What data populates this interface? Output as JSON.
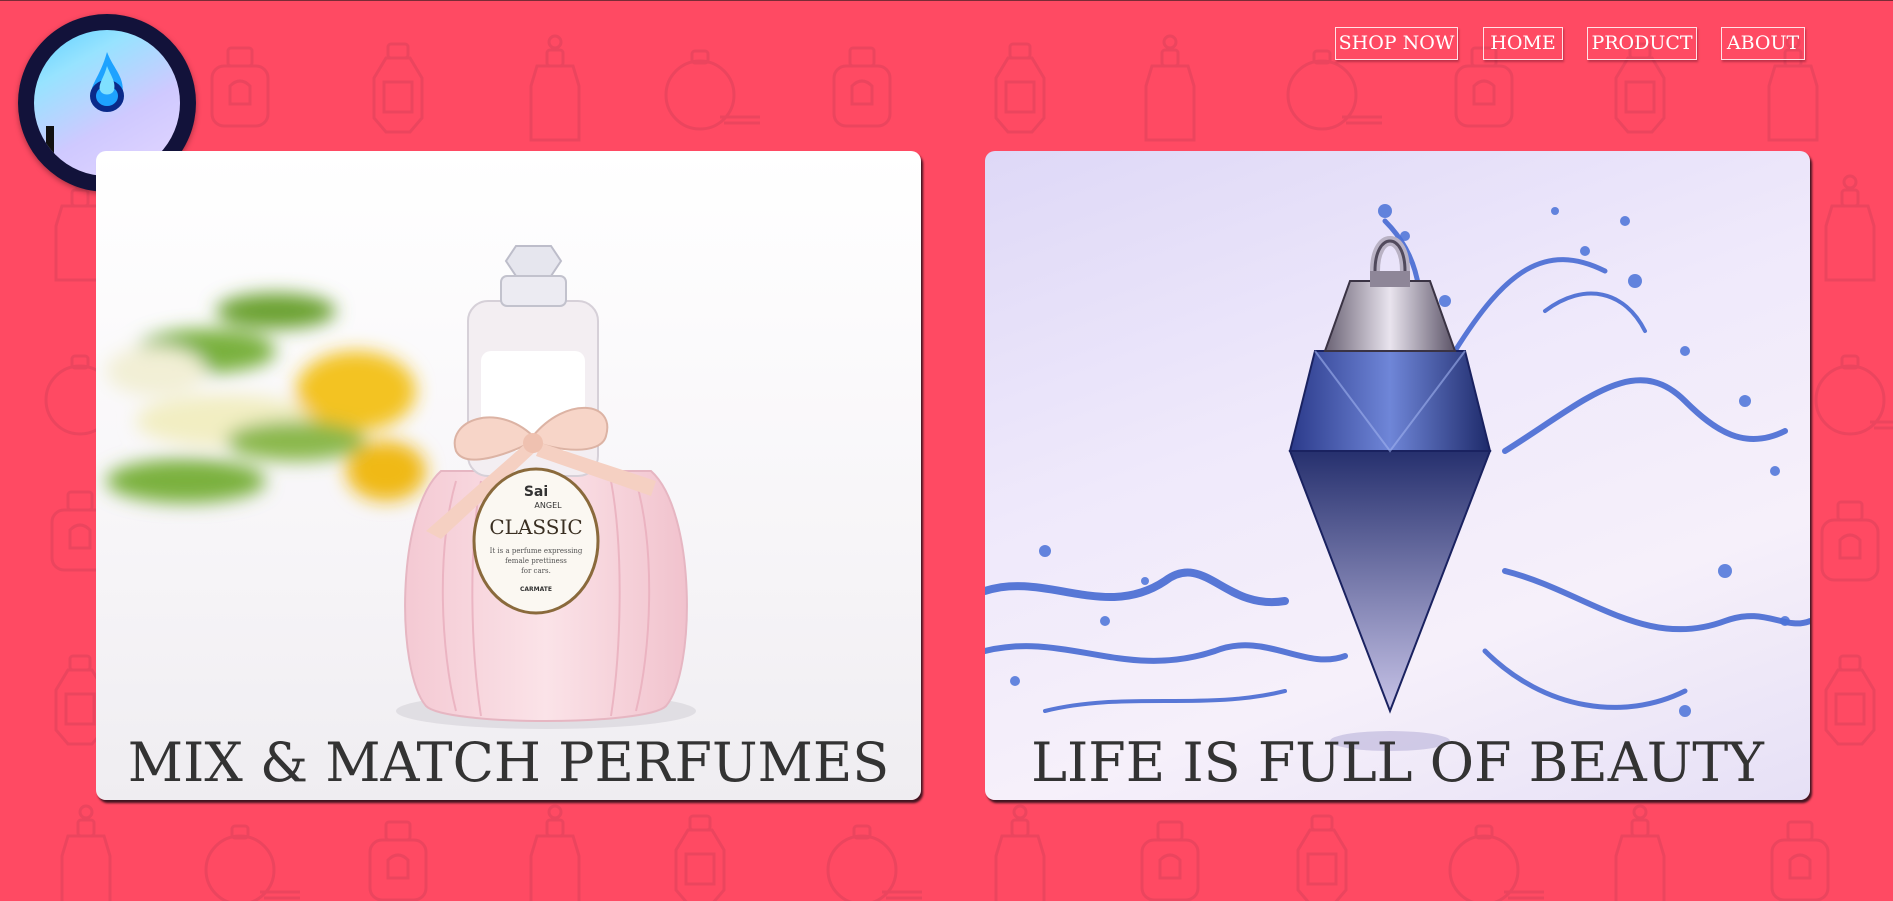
{
  "nav": {
    "items": [
      {
        "label": "SHOP NOW"
      },
      {
        "label": "HOME"
      },
      {
        "label": "PRODUCT"
      },
      {
        "label": "ABOUT"
      }
    ]
  },
  "cards": [
    {
      "caption": "MIX & MATCH PERFUMES",
      "label": {
        "brand": "Sai",
        "sub_brand": "ANGEL",
        "name": "CLASSIC",
        "tagline_1": "It is a perfume expressing",
        "tagline_2": "female prettiness",
        "tagline_3": "for cars.",
        "maker": "CARMATE"
      }
    },
    {
      "caption": "LIFE IS FULL OF BEAUTY"
    }
  ],
  "colors": {
    "background": "#ff4a63",
    "nav_border": "#ffe1e6",
    "caption": "#333333",
    "logo_ring": "#12123a"
  },
  "icons": {
    "pattern": "perfume-bottle-icon",
    "logo": "flame-icon"
  }
}
